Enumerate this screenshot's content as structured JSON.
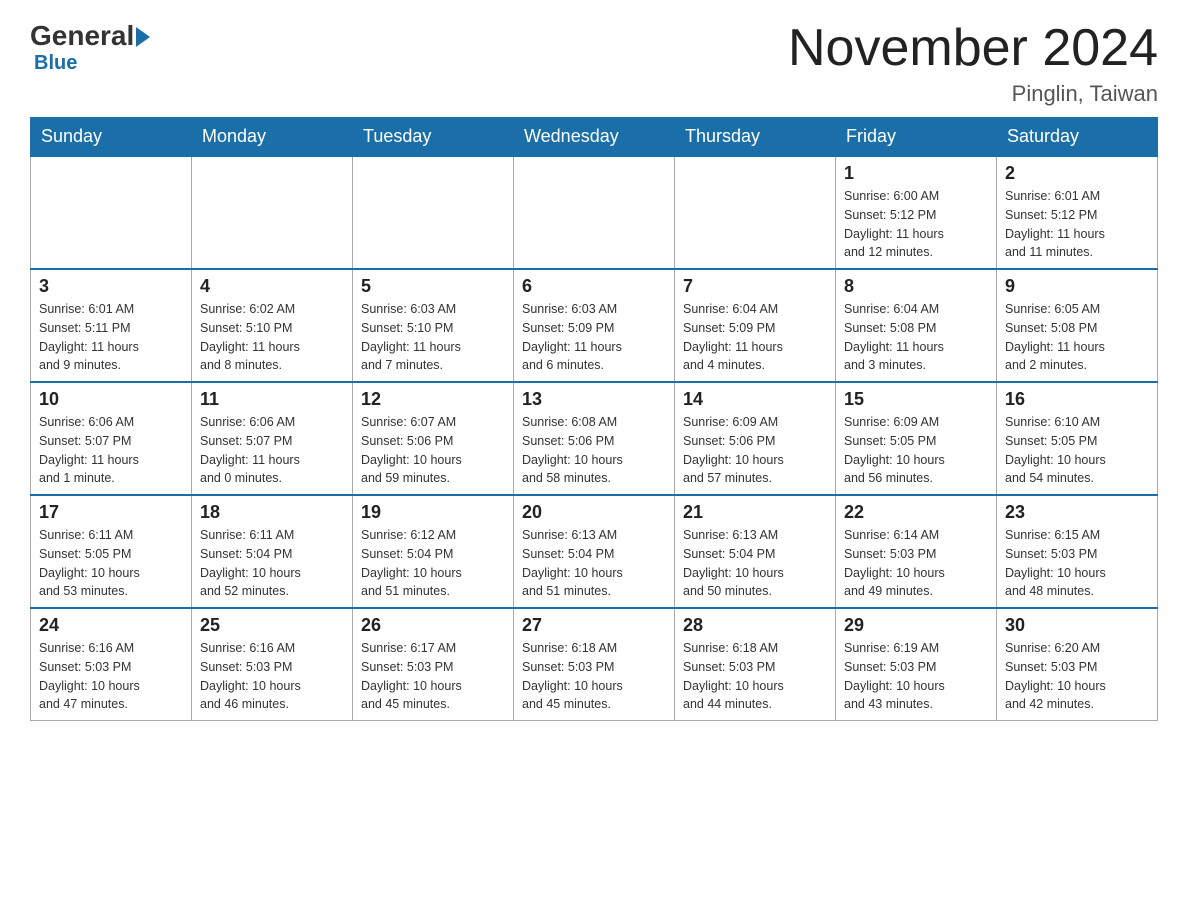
{
  "logo": {
    "general": "General",
    "blue": "Blue",
    "arrow": "▶"
  },
  "header": {
    "title": "November 2024",
    "location": "Pinglin, Taiwan"
  },
  "days_of_week": [
    "Sunday",
    "Monday",
    "Tuesday",
    "Wednesday",
    "Thursday",
    "Friday",
    "Saturday"
  ],
  "weeks": [
    {
      "days": [
        {
          "number": "",
          "info": ""
        },
        {
          "number": "",
          "info": ""
        },
        {
          "number": "",
          "info": ""
        },
        {
          "number": "",
          "info": ""
        },
        {
          "number": "",
          "info": ""
        },
        {
          "number": "1",
          "info": "Sunrise: 6:00 AM\nSunset: 5:12 PM\nDaylight: 11 hours\nand 12 minutes."
        },
        {
          "number": "2",
          "info": "Sunrise: 6:01 AM\nSunset: 5:12 PM\nDaylight: 11 hours\nand 11 minutes."
        }
      ]
    },
    {
      "days": [
        {
          "number": "3",
          "info": "Sunrise: 6:01 AM\nSunset: 5:11 PM\nDaylight: 11 hours\nand 9 minutes."
        },
        {
          "number": "4",
          "info": "Sunrise: 6:02 AM\nSunset: 5:10 PM\nDaylight: 11 hours\nand 8 minutes."
        },
        {
          "number": "5",
          "info": "Sunrise: 6:03 AM\nSunset: 5:10 PM\nDaylight: 11 hours\nand 7 minutes."
        },
        {
          "number": "6",
          "info": "Sunrise: 6:03 AM\nSunset: 5:09 PM\nDaylight: 11 hours\nand 6 minutes."
        },
        {
          "number": "7",
          "info": "Sunrise: 6:04 AM\nSunset: 5:09 PM\nDaylight: 11 hours\nand 4 minutes."
        },
        {
          "number": "8",
          "info": "Sunrise: 6:04 AM\nSunset: 5:08 PM\nDaylight: 11 hours\nand 3 minutes."
        },
        {
          "number": "9",
          "info": "Sunrise: 6:05 AM\nSunset: 5:08 PM\nDaylight: 11 hours\nand 2 minutes."
        }
      ]
    },
    {
      "days": [
        {
          "number": "10",
          "info": "Sunrise: 6:06 AM\nSunset: 5:07 PM\nDaylight: 11 hours\nand 1 minute."
        },
        {
          "number": "11",
          "info": "Sunrise: 6:06 AM\nSunset: 5:07 PM\nDaylight: 11 hours\nand 0 minutes."
        },
        {
          "number": "12",
          "info": "Sunrise: 6:07 AM\nSunset: 5:06 PM\nDaylight: 10 hours\nand 59 minutes."
        },
        {
          "number": "13",
          "info": "Sunrise: 6:08 AM\nSunset: 5:06 PM\nDaylight: 10 hours\nand 58 minutes."
        },
        {
          "number": "14",
          "info": "Sunrise: 6:09 AM\nSunset: 5:06 PM\nDaylight: 10 hours\nand 57 minutes."
        },
        {
          "number": "15",
          "info": "Sunrise: 6:09 AM\nSunset: 5:05 PM\nDaylight: 10 hours\nand 56 minutes."
        },
        {
          "number": "16",
          "info": "Sunrise: 6:10 AM\nSunset: 5:05 PM\nDaylight: 10 hours\nand 54 minutes."
        }
      ]
    },
    {
      "days": [
        {
          "number": "17",
          "info": "Sunrise: 6:11 AM\nSunset: 5:05 PM\nDaylight: 10 hours\nand 53 minutes."
        },
        {
          "number": "18",
          "info": "Sunrise: 6:11 AM\nSunset: 5:04 PM\nDaylight: 10 hours\nand 52 minutes."
        },
        {
          "number": "19",
          "info": "Sunrise: 6:12 AM\nSunset: 5:04 PM\nDaylight: 10 hours\nand 51 minutes."
        },
        {
          "number": "20",
          "info": "Sunrise: 6:13 AM\nSunset: 5:04 PM\nDaylight: 10 hours\nand 51 minutes."
        },
        {
          "number": "21",
          "info": "Sunrise: 6:13 AM\nSunset: 5:04 PM\nDaylight: 10 hours\nand 50 minutes."
        },
        {
          "number": "22",
          "info": "Sunrise: 6:14 AM\nSunset: 5:03 PM\nDaylight: 10 hours\nand 49 minutes."
        },
        {
          "number": "23",
          "info": "Sunrise: 6:15 AM\nSunset: 5:03 PM\nDaylight: 10 hours\nand 48 minutes."
        }
      ]
    },
    {
      "days": [
        {
          "number": "24",
          "info": "Sunrise: 6:16 AM\nSunset: 5:03 PM\nDaylight: 10 hours\nand 47 minutes."
        },
        {
          "number": "25",
          "info": "Sunrise: 6:16 AM\nSunset: 5:03 PM\nDaylight: 10 hours\nand 46 minutes."
        },
        {
          "number": "26",
          "info": "Sunrise: 6:17 AM\nSunset: 5:03 PM\nDaylight: 10 hours\nand 45 minutes."
        },
        {
          "number": "27",
          "info": "Sunrise: 6:18 AM\nSunset: 5:03 PM\nDaylight: 10 hours\nand 45 minutes."
        },
        {
          "number": "28",
          "info": "Sunrise: 6:18 AM\nSunset: 5:03 PM\nDaylight: 10 hours\nand 44 minutes."
        },
        {
          "number": "29",
          "info": "Sunrise: 6:19 AM\nSunset: 5:03 PM\nDaylight: 10 hours\nand 43 minutes."
        },
        {
          "number": "30",
          "info": "Sunrise: 6:20 AM\nSunset: 5:03 PM\nDaylight: 10 hours\nand 42 minutes."
        }
      ]
    }
  ]
}
